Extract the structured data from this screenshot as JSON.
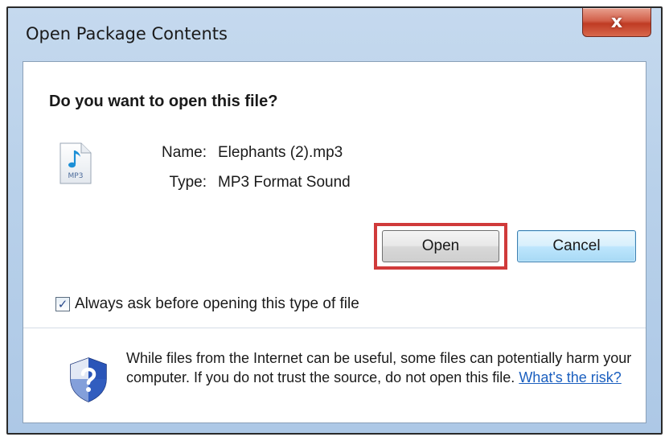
{
  "window": {
    "title": "Open Package Contents",
    "close_glyph": "x"
  },
  "dialog": {
    "question": "Do you want to open this file?",
    "file_icon": "mp3-file-icon",
    "file_icon_caption": "MP3",
    "name_label": "Name:",
    "name_value": "Elephants (2).mp3",
    "type_label": "Type:",
    "type_value": "MP3 Format Sound",
    "open_label": "Open",
    "cancel_label": "Cancel",
    "always_ask_checked": true,
    "always_ask_label": "Always ask before opening this type of file",
    "warning_text": "While files from the Internet can be useful, some files can potentially harm your computer. If you do not trust the source, do not open this file.",
    "risk_link": "What's the risk?",
    "warning_icon": "shield-question-icon"
  },
  "colors": {
    "highlight": "#d03a3a",
    "link": "#1b5fbf",
    "title_bg": "#b9d1ea",
    "close_button": "#c84a30"
  }
}
